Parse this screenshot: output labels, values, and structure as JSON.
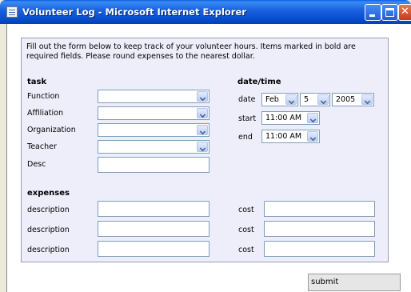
{
  "window": {
    "title": "Volunteer Log - Microsoft Internet Explorer",
    "minimize_glyph": "",
    "close_glyph": "✕"
  },
  "form": {
    "intro": "Fill out the form below to keep track of your volunteer hours. Items marked in bold are required fields. Please round expenses to the nearest dollar.",
    "task": {
      "header": "task",
      "fields": [
        {
          "label": "Function",
          "value": ""
        },
        {
          "label": "Affiliation",
          "value": ""
        },
        {
          "label": "Organization",
          "value": ""
        },
        {
          "label": "Teacher",
          "value": ""
        }
      ],
      "desc_label": "Desc",
      "desc_value": ""
    },
    "datetime": {
      "header": "date/time",
      "date_label": "date",
      "month": "Feb",
      "day": "5",
      "year": "2005",
      "start_label": "start",
      "start_value": "11:00 AM",
      "end_label": "end",
      "end_value": "11:00 AM"
    },
    "expenses": {
      "header": "expenses",
      "rows": [
        {
          "description_label": "description",
          "cost_label": "cost"
        },
        {
          "description_label": "description",
          "cost_label": "cost"
        },
        {
          "description_label": "description",
          "cost_label": "cost"
        }
      ]
    },
    "submit_label": "submit"
  }
}
